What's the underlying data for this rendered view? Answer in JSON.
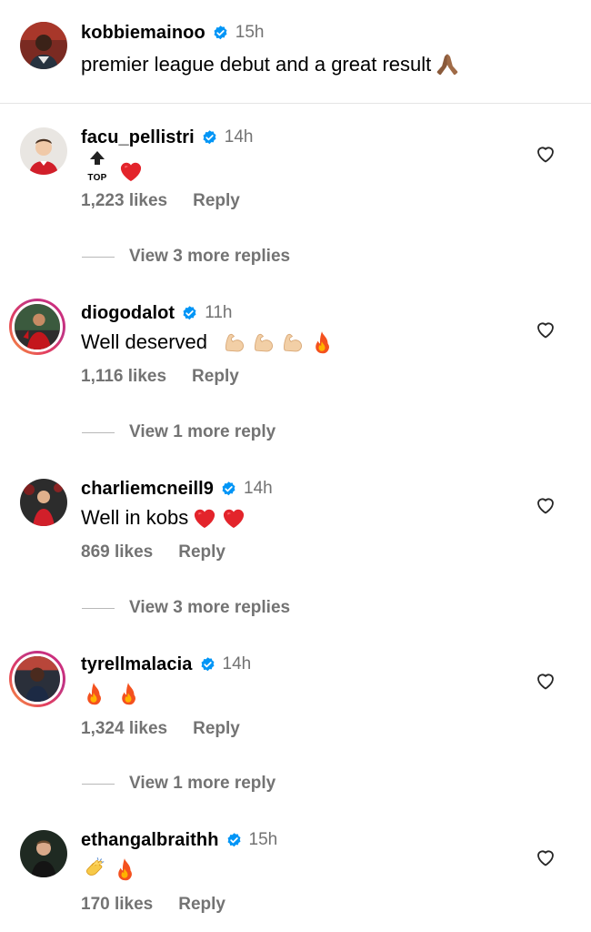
{
  "post": {
    "username": "kobbiemainoo",
    "time": "15h",
    "caption": "premier league debut and a great result"
  },
  "comments": [
    {
      "username": "facu_pellistri",
      "time": "14h",
      "text": "",
      "top_label": "TOP",
      "likes": "1,223 likes",
      "reply_label": "Reply",
      "view_more": "View 3 more replies"
    },
    {
      "username": "diogodalot",
      "time": "11h",
      "text": "Well deserved",
      "likes": "1,116 likes",
      "reply_label": "Reply",
      "view_more": "View 1 more reply"
    },
    {
      "username": "charliemcneill9",
      "time": "14h",
      "text": "Well in kobs",
      "likes": "869 likes",
      "reply_label": "Reply",
      "view_more": "View 3 more replies"
    },
    {
      "username": "tyrellmalacia",
      "time": "14h",
      "text": "",
      "likes": "1,324 likes",
      "reply_label": "Reply",
      "view_more": "View 1 more reply"
    },
    {
      "username": "ethangalbraithh",
      "time": "15h",
      "text": "",
      "likes": "170 likes",
      "reply_label": "Reply"
    }
  ],
  "icons": {
    "verified": "verified-badge-icon",
    "heart": "heart-outline-icon",
    "like_count_suffix": ""
  },
  "colors": {
    "verified": "#0095f6",
    "muted": "#737373",
    "story_ring": "#e4405f"
  }
}
